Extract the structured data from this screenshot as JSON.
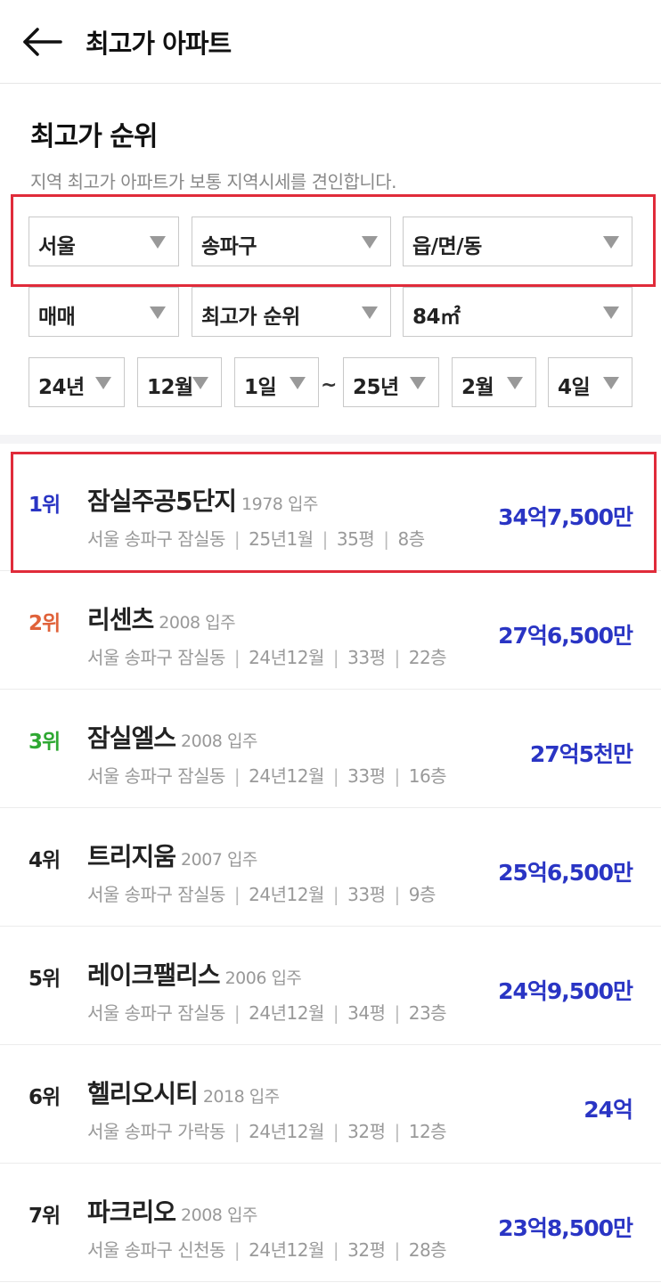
{
  "header": {
    "title": "최고가 아파트"
  },
  "section": {
    "title": "최고가 순위",
    "description": "지역 최고가 아파트가 보통 지역시세를 견인합니다."
  },
  "filters": {
    "region": "서울",
    "district": "송파구",
    "town": "읍/면/동",
    "deal_type": "매매",
    "sort": "최고가 순위",
    "area": "84㎡",
    "start_year": "24년",
    "start_month": "12월",
    "start_day": "1일",
    "range_sep": "~",
    "end_year": "25년",
    "end_month": "2월",
    "end_day": "4일"
  },
  "colors": {
    "rank1": "#2a35c4",
    "rank2": "#e0623a",
    "rank3": "#2ea832",
    "rank_default": "#222222",
    "price": "#2a35c4",
    "highlight": "#e02b3a"
  },
  "rows": [
    {
      "rank": "1위",
      "name": "잠실주공5단지",
      "year": "1978 입주",
      "location": "서울 송파구 잠실동",
      "date": "25년1월",
      "size": "35평",
      "floor": "8층",
      "price": "34억7,500만"
    },
    {
      "rank": "2위",
      "name": "리센츠",
      "year": "2008 입주",
      "location": "서울 송파구 잠실동",
      "date": "24년12월",
      "size": "33평",
      "floor": "22층",
      "price": "27억6,500만"
    },
    {
      "rank": "3위",
      "name": "잠실엘스",
      "year": "2008 입주",
      "location": "서울 송파구 잠실동",
      "date": "24년12월",
      "size": "33평",
      "floor": "16층",
      "price": "27억5천만"
    },
    {
      "rank": "4위",
      "name": "트리지움",
      "year": "2007 입주",
      "location": "서울 송파구 잠실동",
      "date": "24년12월",
      "size": "33평",
      "floor": "9층",
      "price": "25억6,500만"
    },
    {
      "rank": "5위",
      "name": "레이크팰리스",
      "year": "2006 입주",
      "location": "서울 송파구 잠실동",
      "date": "24년12월",
      "size": "34평",
      "floor": "23층",
      "price": "24억9,500만"
    },
    {
      "rank": "6위",
      "name": "헬리오시티",
      "year": "2018 입주",
      "location": "서울 송파구 가락동",
      "date": "24년12월",
      "size": "32평",
      "floor": "12층",
      "price": "24억"
    },
    {
      "rank": "7위",
      "name": "파크리오",
      "year": "2008 입주",
      "location": "서울 송파구 신천동",
      "date": "24년12월",
      "size": "32평",
      "floor": "28층",
      "price": "23억8,500만"
    }
  ]
}
